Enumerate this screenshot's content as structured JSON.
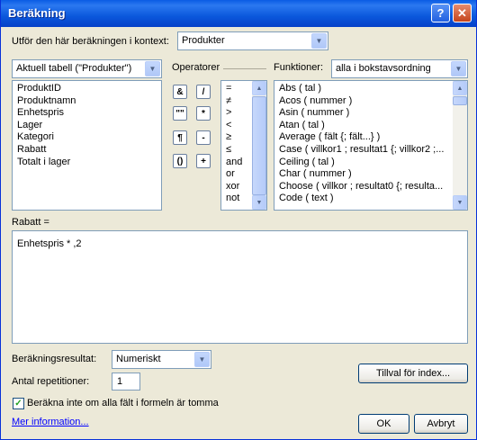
{
  "window": {
    "title": "Beräkning"
  },
  "context": {
    "label": "Utför den här beräkningen i kontext:",
    "value": "Produkter"
  },
  "fields": {
    "table_selector": "Aktuell tabell (\"Produkter\")",
    "items": [
      "ProduktID",
      "Produktnamn",
      "Enhetspris",
      "Lager",
      "Kategori",
      "Rabatt",
      "Totalt i lager"
    ]
  },
  "operators": {
    "label": "Operatorer",
    "buttons": [
      "&",
      "/",
      "\"\"",
      "*",
      "¶",
      "-",
      "()",
      "+"
    ],
    "list": [
      "=",
      "≠",
      ">",
      "<",
      "≥",
      "≤",
      "and",
      "or",
      "xor",
      "not"
    ]
  },
  "functions": {
    "label": "Funktioner:",
    "filter": "alla i bokstavsordning",
    "items": [
      "Abs ( tal )",
      "Acos ( nummer )",
      "Asin ( nummer )",
      "Atan ( tal )",
      "Average ( fält {; fält...} )",
      "Case ( villkor1 ; resultat1 {; villkor2 ;...",
      "Ceiling ( tal )",
      "Char ( nummer )",
      "Choose ( villkor ; resultat0 {; resulta...",
      "Code ( text )"
    ]
  },
  "formula": {
    "label": "Rabatt =",
    "text": "Enhetspris * ,2"
  },
  "result": {
    "label": "Beräkningsresultat:",
    "value": "Numeriskt"
  },
  "repetitions": {
    "label": "Antal repetitioner:",
    "value": "1"
  },
  "checkbox": {
    "label": "Beräkna inte om alla fält i formeln är tomma",
    "checked": true
  },
  "buttons": {
    "index_options": "Tillval för index...",
    "ok": "OK",
    "cancel": "Avbryt"
  },
  "link": "Mer information..."
}
